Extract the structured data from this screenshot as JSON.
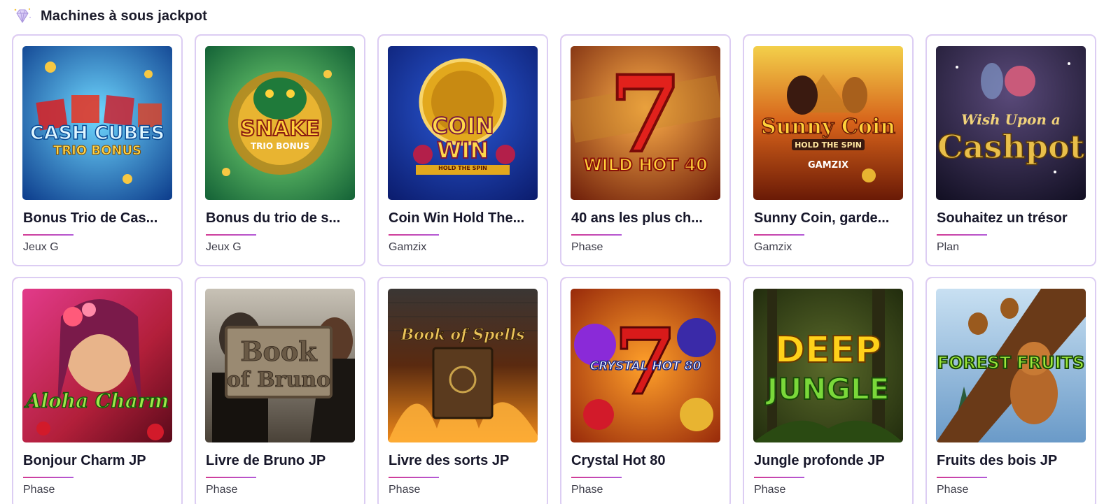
{
  "section": {
    "title": "Machines à sous jackpot",
    "icon": "diamond-icon"
  },
  "colors": {
    "card_border": "#dccdf3",
    "card_accent": "#e0418f",
    "title_text": "#17172a",
    "provider_text": "#3c3c48"
  },
  "games": [
    {
      "name": "Bonus Trio de Cas...",
      "provider": "Jeux G",
      "thumbnail_text": [
        "CASH CUBES",
        "TRIO BONUS"
      ]
    },
    {
      "name": "Bonus du trio de s...",
      "provider": "Jeux G",
      "thumbnail_text": [
        "SNAKE",
        "TRIO BONUS"
      ]
    },
    {
      "name": "Coin Win Hold The...",
      "provider": "Gamzix",
      "thumbnail_text": [
        "COIN",
        "WIN",
        "HOLD THE SPIN"
      ]
    },
    {
      "name": "40 ans les plus ch...",
      "provider": "Phase",
      "thumbnail_text": [
        "7",
        "WILD HOT 40"
      ]
    },
    {
      "name": "Sunny Coin, garde...",
      "provider": "Gamzix",
      "thumbnail_text": [
        "Sunny Coin",
        "HOLD THE SPIN",
        "GAMZIX"
      ]
    },
    {
      "name": "Souhaitez un trésor",
      "provider": "Plan",
      "thumbnail_text": [
        "Wish Upon a",
        "Cashpot"
      ]
    },
    {
      "name": "Bonjour Charm JP",
      "provider": "Phase",
      "thumbnail_text": [
        "Aloha Charm"
      ]
    },
    {
      "name": "Livre de Bruno JP",
      "provider": "Phase",
      "thumbnail_text": [
        "Book",
        "of Bruno"
      ]
    },
    {
      "name": "Livre des sorts JP",
      "provider": "Phase",
      "thumbnail_text": [
        "Book of Spells"
      ]
    },
    {
      "name": "Crystal Hot 80",
      "provider": "Phase",
      "thumbnail_text": [
        "7",
        "CRYSTAL HOT 80"
      ]
    },
    {
      "name": "Jungle profonde JP",
      "provider": "Phase",
      "thumbnail_text": [
        "DEEP",
        "JUNGLE"
      ]
    },
    {
      "name": "Fruits des bois JP",
      "provider": "Phase",
      "thumbnail_text": [
        "FOREST FRUITS"
      ]
    }
  ]
}
